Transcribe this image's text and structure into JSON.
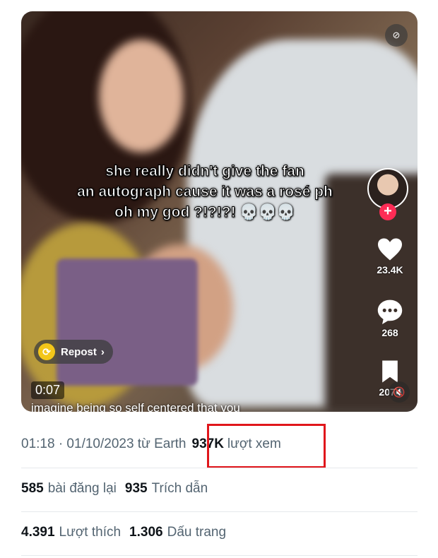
{
  "video": {
    "caption": "she really didn't give the fan\nan autograph cause it was a rosé ph\noh my god ?!?!?! 💀💀💀",
    "like_count": "23.4K",
    "comment_count": "268",
    "bookmark_count": "2075",
    "repost_label": "Repost",
    "repost_chevron": "›",
    "timestamp": "0:07",
    "bottom_caption": "imagine being so self centered that you",
    "follow_symbol": "+",
    "icons": [
      "no-caption-icon",
      "heart-icon",
      "comment-icon",
      "bookmark-icon",
      "repost-icon",
      "mute-icon"
    ]
  },
  "post_meta": {
    "time_date": "01:18 · 01/10/2023 từ Earth",
    "views_count": "937K",
    "views_label": "lượt xem"
  },
  "stats": {
    "reposts_count": "585",
    "reposts_label": "bài đăng lại",
    "quotes_count": "935",
    "quotes_label": "Trích dẫn",
    "likes_count": "4.391",
    "likes_label": "Lượt thích",
    "bookmarks_count": "1.306",
    "bookmarks_label": "Dấu trang"
  },
  "colors": {
    "highlight_border": "#e0161b",
    "tiktok_red": "#fe2c55",
    "repost_yellow": "#f3c619",
    "secondary_text": "#536471"
  }
}
